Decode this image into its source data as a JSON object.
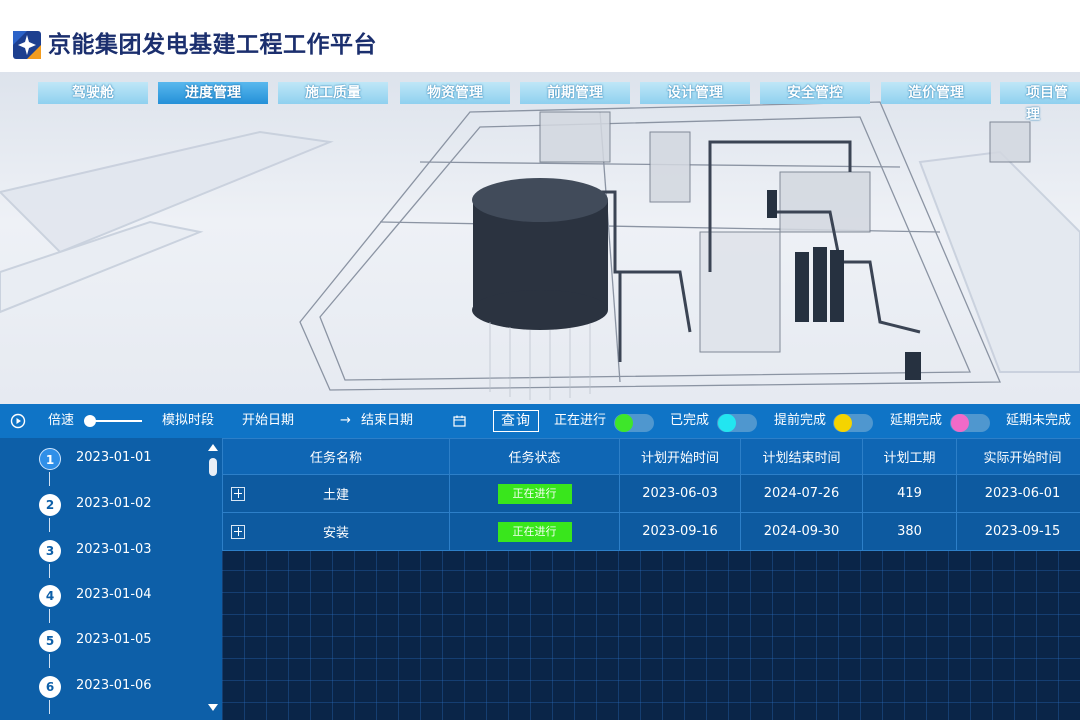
{
  "header": {
    "title": "京能集团发电基建工程工作平台"
  },
  "nav": {
    "tabs": [
      {
        "label": "驾驶舱",
        "active": false
      },
      {
        "label": "进度管理",
        "active": true
      },
      {
        "label": "施工质量",
        "active": false
      },
      {
        "label": "物资管理",
        "active": false
      },
      {
        "label": "前期管理",
        "active": false
      },
      {
        "label": "设计管理",
        "active": false
      },
      {
        "label": "安全管控",
        "active": false
      },
      {
        "label": "造价管理",
        "active": false
      },
      {
        "label": "项目管理",
        "active": false
      }
    ]
  },
  "controls": {
    "speed_label": "倍速",
    "simulate_label": "模拟时段",
    "start_date_label": "开始日期",
    "arrow": "→",
    "end_date_label": "结束日期",
    "query_label": "查询",
    "legend": [
      {
        "label": "正在进行",
        "color": "#3ee62a"
      },
      {
        "label": "已完成",
        "color": "#22e6f0"
      },
      {
        "label": "提前完成",
        "color": "#f5d400"
      },
      {
        "label": "延期完成",
        "color": "#f06ac8"
      },
      {
        "label": "延期未完成",
        "color": "#ff3b3b"
      }
    ]
  },
  "timeline": {
    "items": [
      {
        "index": "1",
        "date": "2023-01-01",
        "active": true
      },
      {
        "index": "2",
        "date": "2023-01-02",
        "active": false
      },
      {
        "index": "3",
        "date": "2023-01-03",
        "active": false
      },
      {
        "index": "4",
        "date": "2023-01-04",
        "active": false
      },
      {
        "index": "5",
        "date": "2023-01-05",
        "active": false
      },
      {
        "index": "6",
        "date": "2023-01-06",
        "active": false
      }
    ]
  },
  "table": {
    "headers": [
      "任务名称",
      "任务状态",
      "计划开始时间",
      "计划结束时间",
      "计划工期",
      "实际开始时间"
    ],
    "rows": [
      {
        "name": "土建",
        "status": "正在进行",
        "plan_start": "2023-06-03",
        "plan_end": "2024-07-26",
        "duration": "419",
        "actual_start": "2023-06-01"
      },
      {
        "name": "安装",
        "status": "正在进行",
        "plan_start": "2023-09-16",
        "plan_end": "2024-09-30",
        "duration": "380",
        "actual_start": "2023-09-15"
      }
    ]
  },
  "colors": {
    "status_in_progress": "#39e61c",
    "control_bar": "#0f74c6",
    "table_header": "#0f66b4"
  }
}
